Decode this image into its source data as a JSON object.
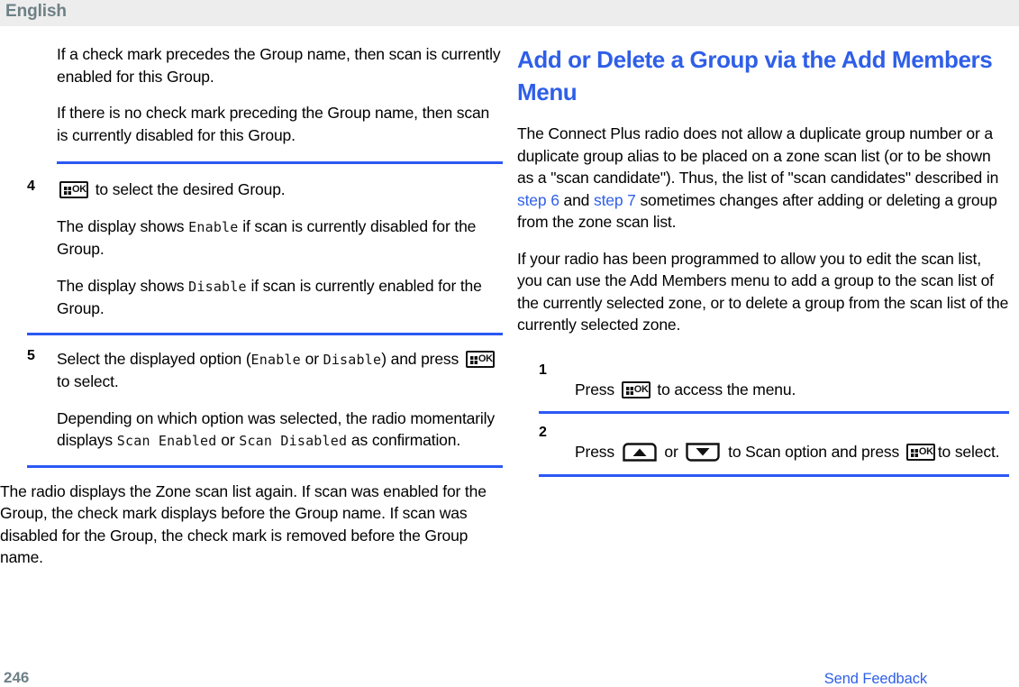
{
  "header": {
    "language": "English"
  },
  "footer": {
    "page_number": "246",
    "feedback_link": "Send Feedback"
  },
  "colors": {
    "accent_blue": "#2b58f4",
    "link_blue": "#2f5fe8",
    "header_bg": "#ededed",
    "header_text": "#6e8086",
    "body_text": "#010101"
  },
  "icons": {
    "ok_key": "ok-key-icon",
    "up_arrow_key": "up-arrow-key-icon",
    "down_arrow_key": "down-arrow-key-icon"
  },
  "left_column": {
    "note_1": "If a check mark precedes the Group name, then scan is currently enabled for this Group.",
    "note_2": "If there is no check mark preceding the Group name, then scan is currently disabled for this Group.",
    "step4": {
      "number": "4",
      "lead_suffix": " to select the desired Group.",
      "sub_1_pre": "The display shows ",
      "sub_1_mono": "Enable",
      "sub_1_post": " if scan is currently disabled for the Group.",
      "sub_2_pre": "The display shows ",
      "sub_2_mono": "Disable",
      "sub_2_post": " if scan is currently enabled for the Group."
    },
    "step5": {
      "number": "5",
      "line_a_pre": "Select the displayed option (",
      "line_a_mono1": "Enable",
      "line_a_mid": " or ",
      "line_a_mono2": "Disable",
      "line_a_post": ") and press",
      "line_b_post": " to select.",
      "sub_pre": "Depending on which option was selected, the radio momentarily displays ",
      "sub_mono1": "Scan Enabled",
      "sub_mid": " or ",
      "sub_mono2": "Scan Disabled",
      "sub_post": " as confirmation."
    },
    "closing": "The radio displays the Zone scan list again. If scan was enabled for the Group, the check mark displays before the Group name. If scan was disabled for the Group, the check mark is removed before the Group name."
  },
  "right_column": {
    "heading": "Add or Delete a Group via the Add Members Menu",
    "para_1_pre": "The Connect Plus radio does not allow a duplicate group number or a duplicate group alias to be placed on a zone scan list (or to be shown as a \"scan candidate\"). Thus, the list of \"scan candidates\" described in ",
    "para_1_link1": "step 6",
    "para_1_mid": " and ",
    "para_1_link2": "step 7",
    "para_1_post": " sometimes changes after adding or deleting a group from the zone scan list.",
    "para_2": "If your radio has been programmed to allow you to edit the scan list, you can use the Add Members menu to add a group to the scan list of the currently selected zone, or to delete a group from the scan list of the currently selected zone.",
    "step1": {
      "number": "1",
      "pre": "Press",
      "post": " to access the menu."
    },
    "step2": {
      "number": "2",
      "pre": "Press",
      "mid": " or ",
      "post": " to Scan option and press",
      "tail": "to select."
    }
  }
}
